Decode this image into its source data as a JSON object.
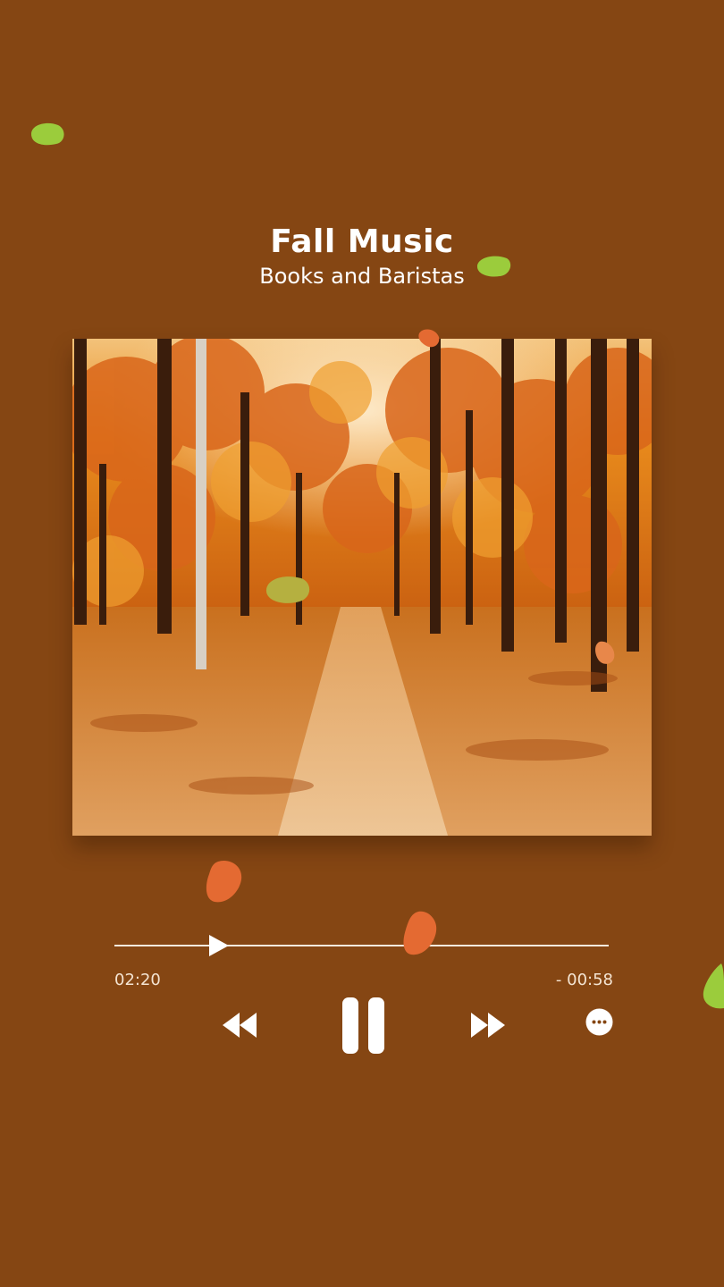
{
  "player": {
    "title": "Fall Music",
    "subtitle": "Books and Baristas",
    "elapsed": "02:20",
    "remaining": "- 00:58",
    "progress_fraction": 0.2
  },
  "controls": {
    "rewind_icon": "rewind-icon",
    "pause_icon": "pause-icon",
    "forward_icon": "fast-forward-icon",
    "more_icon": "more-options-icon"
  },
  "colors": {
    "background": "#854613",
    "text": "#ffffff",
    "leaf_green": "#9bcc3c",
    "leaf_orange": "#e46a32"
  }
}
